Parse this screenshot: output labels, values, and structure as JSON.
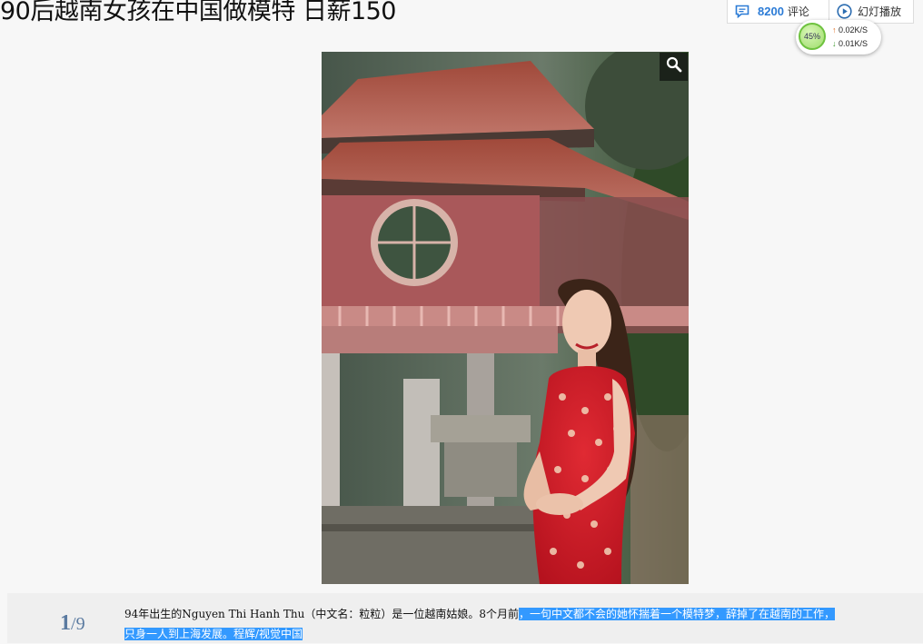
{
  "page": {
    "title": "90后越南女孩在中国做模特 日薪150"
  },
  "toolbar": {
    "comment_count": "8200",
    "comment_label": "评论",
    "slideshow_label": "幻灯播放",
    "comment_icon": "comment-icon",
    "slideshow_icon": "play-circle-icon",
    "accent_color": "#2b7bd6"
  },
  "net_monitor": {
    "percent": "45%",
    "upload": "0.02K/S",
    "download": "0.01K/S"
  },
  "gallery": {
    "zoom_icon": "magnifier-icon",
    "current": "1",
    "separator": "/",
    "total": "9",
    "caption_plain": "94年出生的Nguyen Thi Hanh Thu（中文名：粒粒）是一位越南姑娘。8个月前",
    "caption_selected_1": "，一句中文都不会的她怀揣着一个模特梦，辞掉了在越南的工作，",
    "caption_selected_2": "只身一人到上海发展。程辉/视觉中国",
    "selection_color": "#3399ff"
  }
}
